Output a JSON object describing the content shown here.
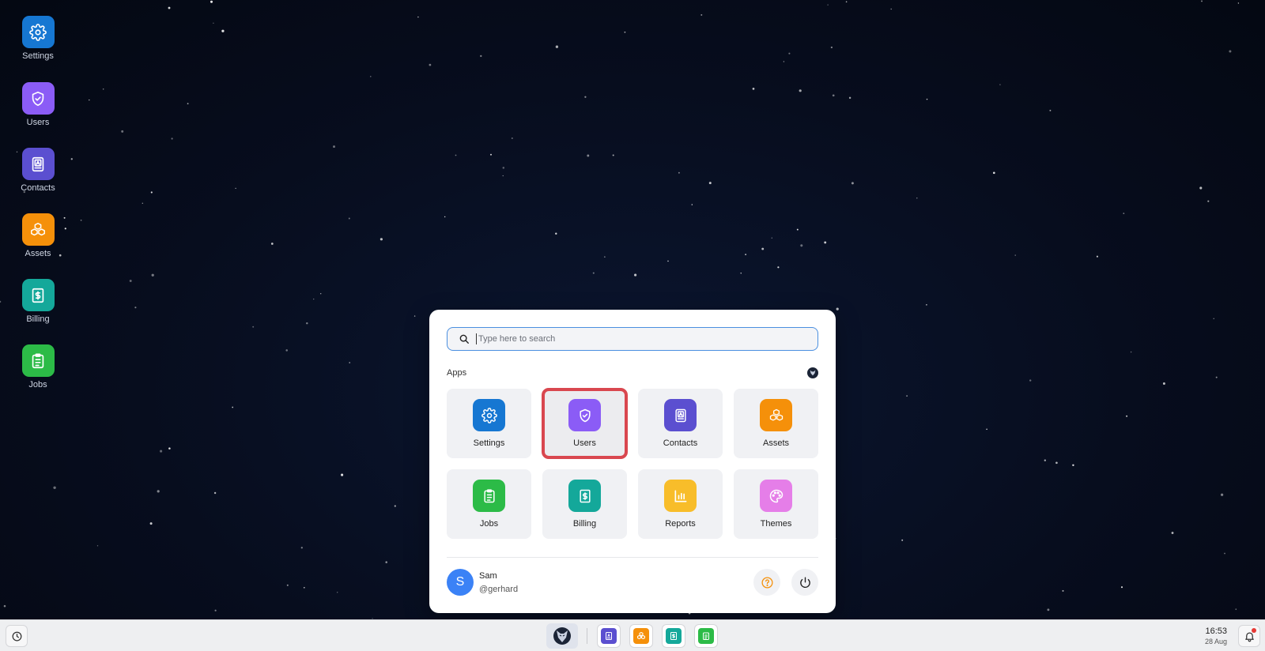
{
  "colors": {
    "settings": "#1677d2",
    "users": "#8b5cf6",
    "contacts": "#5b4fd0",
    "assets": "#f5900a",
    "billing": "#14a89a",
    "jobs": "#2cbb47",
    "reports": "#f8bd2a",
    "themes": "#e57ee8",
    "selection": "#d9474f",
    "avatar": "#3b82f6"
  },
  "desktop": {
    "icons": [
      {
        "label": "Settings",
        "icon": "gear-icon"
      },
      {
        "label": "Users",
        "icon": "shield-check-icon"
      },
      {
        "label": "Contacts",
        "icon": "contact-book-icon"
      },
      {
        "label": "Assets",
        "icon": "cubes-icon"
      },
      {
        "label": "Billing",
        "icon": "dollar-receipt-icon"
      },
      {
        "label": "Jobs",
        "icon": "clipboard-icon"
      }
    ]
  },
  "start_menu": {
    "search": {
      "placeholder": "Type here to search",
      "value": ""
    },
    "section_title": "Apps",
    "apps": [
      {
        "label": "Settings",
        "icon": "gear-icon"
      },
      {
        "label": "Users",
        "icon": "shield-check-icon",
        "selected": true
      },
      {
        "label": "Contacts",
        "icon": "contact-book-icon"
      },
      {
        "label": "Assets",
        "icon": "cubes-icon"
      },
      {
        "label": "Jobs",
        "icon": "clipboard-icon"
      },
      {
        "label": "Billing",
        "icon": "dollar-receipt-icon"
      },
      {
        "label": "Reports",
        "icon": "bar-chart-icon"
      },
      {
        "label": "Themes",
        "icon": "palette-icon"
      }
    ],
    "user": {
      "initial": "S",
      "name": "Sam",
      "handle": "@gerhard"
    },
    "help_icon": "help-circle-icon",
    "power_icon": "power-icon"
  },
  "taskbar": {
    "clock": {
      "time": "16:53",
      "date": "28 Aug"
    },
    "pinned": [
      "contacts",
      "assets",
      "billing",
      "jobs"
    ]
  }
}
